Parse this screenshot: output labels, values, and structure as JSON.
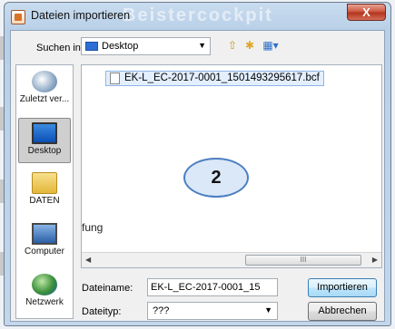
{
  "window": {
    "title": "Dateien importieren",
    "watermark": "Beistercockpit",
    "close_label": "X"
  },
  "toolbar": {
    "lookin_label": "Suchen in:",
    "lookin_value": "Desktop",
    "icons": [
      "up-folder-icon",
      "new-folder-icon",
      "view-menu-icon"
    ]
  },
  "places": [
    {
      "label": "Zuletzt ver...",
      "icon": "recent-places-icon"
    },
    {
      "label": "Desktop",
      "icon": "desktop-icon",
      "selected": true
    },
    {
      "label": "DATEN",
      "icon": "folder-icon"
    },
    {
      "label": "Computer",
      "icon": "computer-icon"
    },
    {
      "label": "Netzwerk",
      "icon": "network-icon"
    }
  ],
  "file_list": {
    "items": [
      "EK-L_EC-2017-0001_1501493295617.bcf"
    ],
    "partial_text": "fung",
    "callout": "2",
    "scroll_thumb": "III"
  },
  "filename": {
    "label": "Dateiname:",
    "value": "EK-L_EC-2017-0001_15"
  },
  "filetype": {
    "label": "Dateityp:",
    "value": "???"
  },
  "buttons": {
    "import": "Importieren",
    "cancel": "Abbrechen"
  }
}
